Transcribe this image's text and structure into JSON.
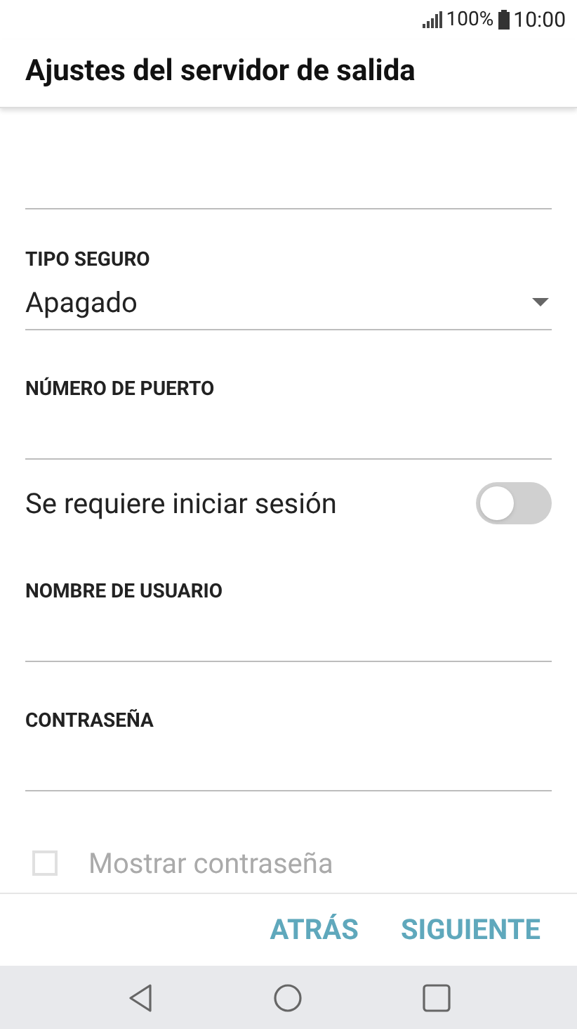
{
  "status_bar": {
    "battery": "100%",
    "time": "10:00"
  },
  "title": "Ajustes del servidor de salida",
  "fields": [
    {
      "kind": "text"
    },
    {
      "kind": "dropdown",
      "label": "TIPO SEGURO",
      "value": "Apagado"
    },
    {
      "kind": "text",
      "label": "NÚMERO DE PUERTO"
    },
    {
      "kind": "toggle",
      "label": "Se requiere iniciar sesión",
      "on": false
    },
    {
      "kind": "text",
      "label": "NOMBRE DE USUARIO"
    },
    {
      "kind": "text",
      "label": "CONTRASEÑA"
    }
  ],
  "show_password": {
    "label": "Mostrar contraseña",
    "checked": false,
    "disabled": true
  },
  "buttons": [
    "ATRÁS",
    "SIGUIENTE"
  ]
}
